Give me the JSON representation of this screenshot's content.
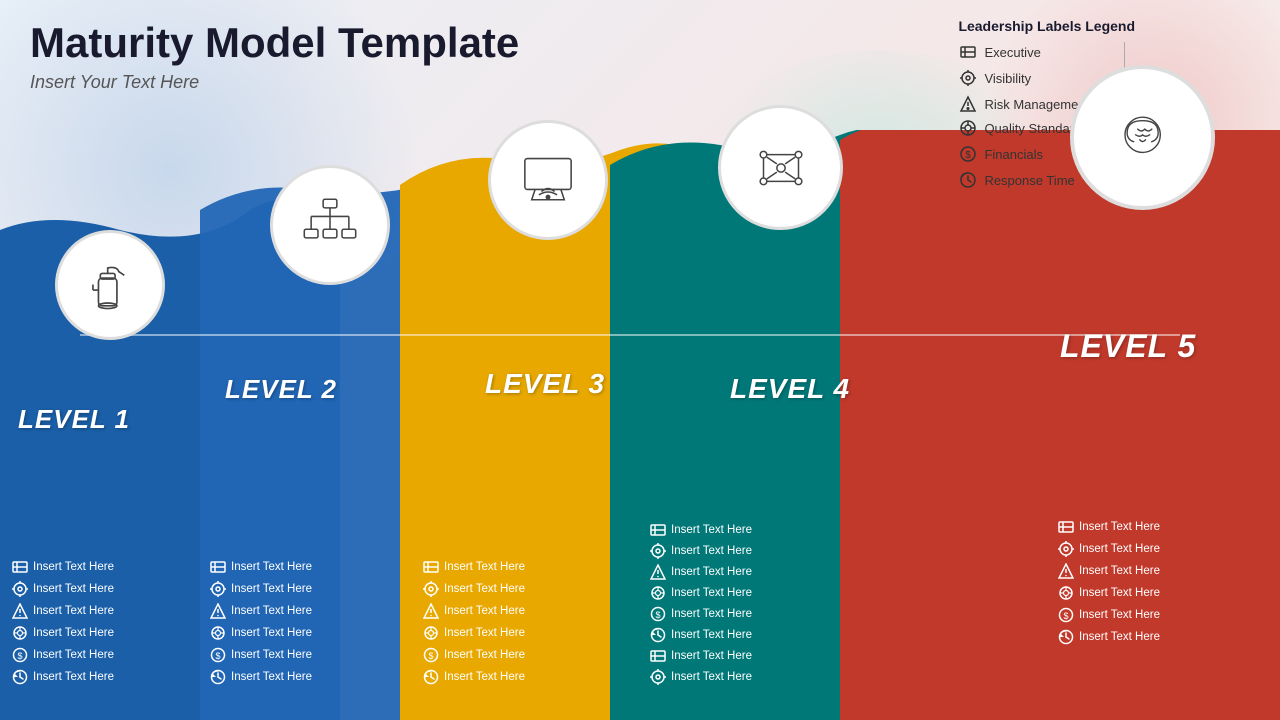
{
  "header": {
    "title": "Maturity Model Template",
    "subtitle": "Insert Your Text Here"
  },
  "legend": {
    "title": "Leadership Labels Legend",
    "left_items": [
      {
        "icon": "executive",
        "label": "Executive"
      },
      {
        "icon": "visibility",
        "label": "Visibility"
      },
      {
        "icon": "risk",
        "label": "Risk Management"
      }
    ],
    "right_items": [
      {
        "icon": "quality",
        "label": "Quality Standards"
      },
      {
        "icon": "financials",
        "label": "Financials"
      },
      {
        "icon": "response",
        "label": "Response Time"
      }
    ]
  },
  "levels": [
    {
      "id": "level-1",
      "title": "LEVEL 1",
      "color": "#1a5fa8",
      "items": [
        "Insert Text Here",
        "Insert Text Here",
        "Insert Text Here",
        "Insert Text Here",
        "Insert Text Here",
        "Insert Text Here"
      ]
    },
    {
      "id": "level-2",
      "title": "LEVEL 2",
      "color": "#1a5fa8",
      "items": [
        "Insert Text Here",
        "Insert Text Here",
        "Insert Text Here",
        "Insert Text Here",
        "Insert Text Here",
        "Insert Text Here"
      ]
    },
    {
      "id": "level-3",
      "title": "LEVEL 3",
      "color": "#e8a800",
      "items": [
        "Insert Text Here",
        "Insert Text Here",
        "Insert Text Here",
        "Insert Text Here",
        "Insert Text Here",
        "Insert Text Here"
      ]
    },
    {
      "id": "level-4",
      "title": "LEVEL 4",
      "color": "#008080",
      "items": [
        "Insert Text Here",
        "Insert Text Here",
        "Insert Text Here",
        "Insert Text Here",
        "Insert Text Here",
        "Insert Text Here",
        "Insert Text Here",
        "Insert Text Here"
      ]
    },
    {
      "id": "level-5",
      "title": "LEVEL 5",
      "color": "#c0392b",
      "items": [
        "Insert Text Here",
        "Insert Text Here",
        "Insert Text Here",
        "Insert Text Here",
        "Insert Text Here",
        "Insert Text Here"
      ]
    }
  ],
  "icons": {
    "executive": "⊟",
    "visibility": "⚙",
    "risk": "⬆",
    "quality": "⊙",
    "financials": "⊕",
    "response": "↺"
  }
}
